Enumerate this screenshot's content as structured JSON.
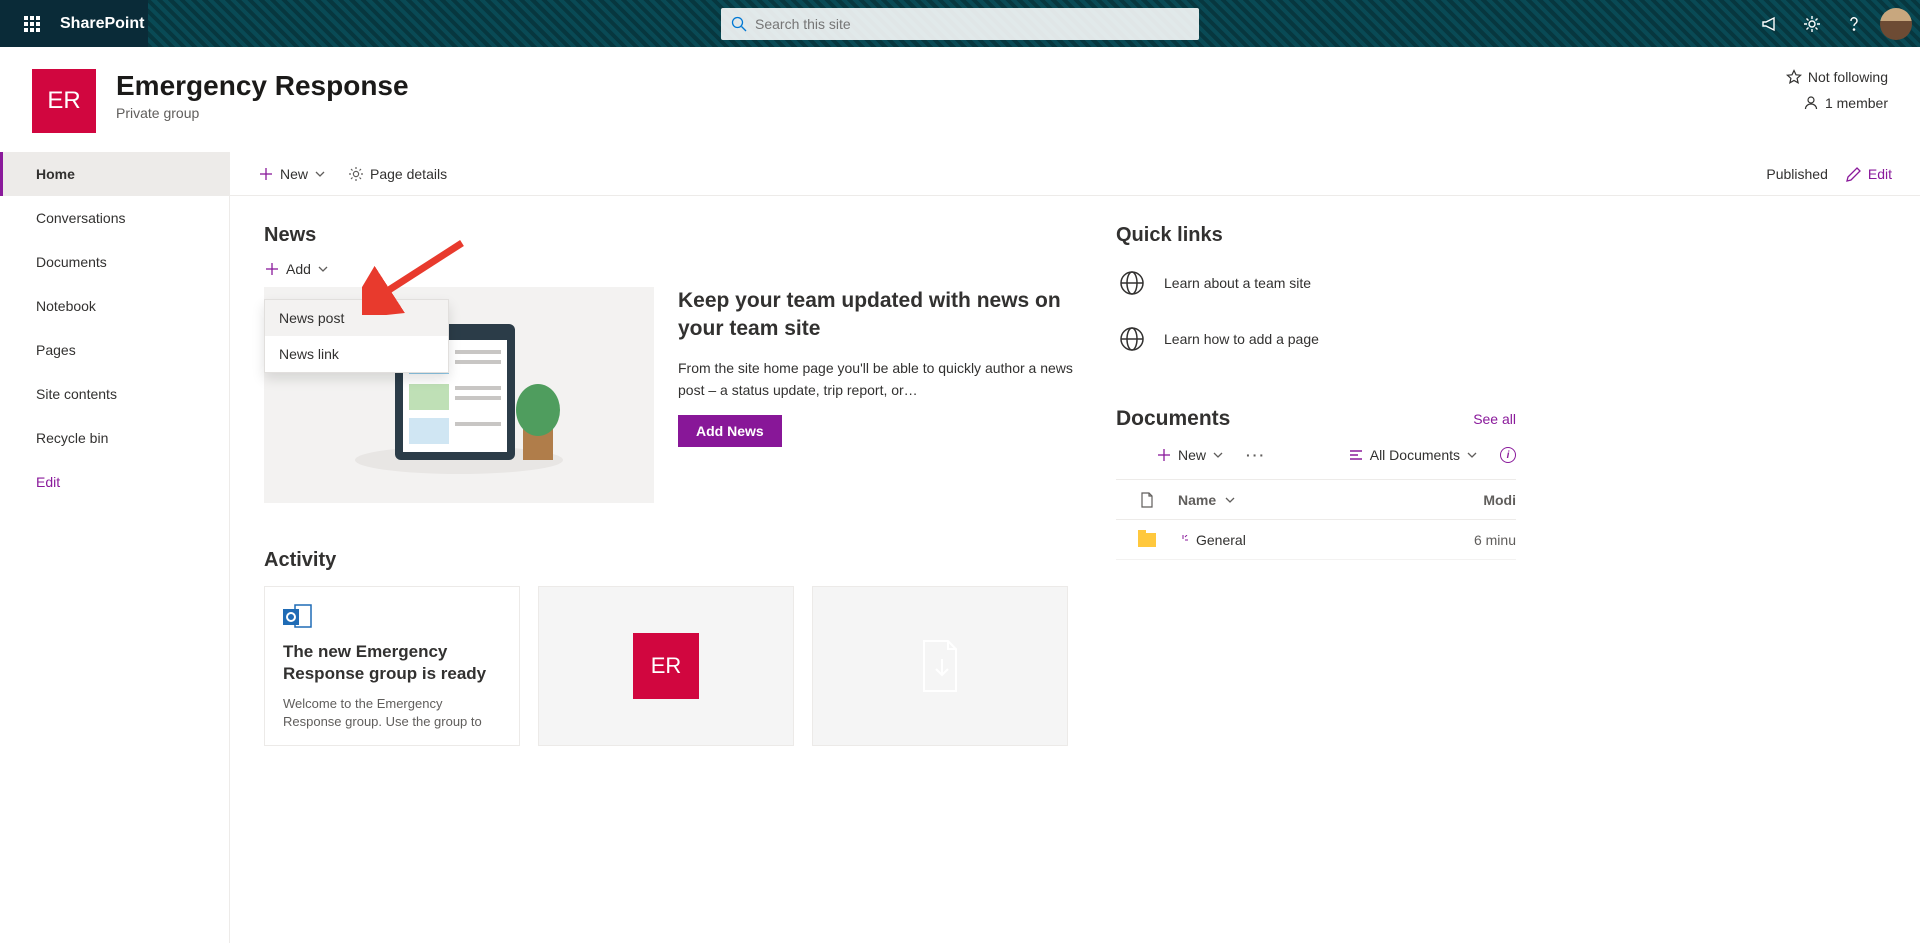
{
  "suite": {
    "app_name": "SharePoint",
    "search_placeholder": "Search this site"
  },
  "site": {
    "logo_text": "ER",
    "name": "Emergency Response",
    "subtitle": "Private group",
    "follow": "Not following",
    "members": "1 member"
  },
  "nav": {
    "items": [
      "Home",
      "Conversations",
      "Documents",
      "Notebook",
      "Pages",
      "Site contents",
      "Recycle bin"
    ],
    "edit": "Edit"
  },
  "cmdbar": {
    "new": "New",
    "page_details": "Page details",
    "published": "Published",
    "edit": "Edit"
  },
  "news": {
    "heading": "News",
    "add": "Add",
    "menu": [
      "News post",
      "News link"
    ],
    "title": "Keep your team updated with news on your team site",
    "desc": "From the site home page you'll be able to quickly author a news post – a status update, trip report, or…",
    "button": "Add News"
  },
  "activity": {
    "heading": "Activity",
    "card1_title": "The new Emergency Response group is ready",
    "card1_body": "Welcome to the Emergency Response group. Use the group to",
    "card2_tile": "ER"
  },
  "quicklinks": {
    "heading": "Quick links",
    "items": [
      "Learn about a team site",
      "Learn how to add a page"
    ]
  },
  "documents": {
    "heading": "Documents",
    "see_all": "See all",
    "new": "New",
    "view": "All Documents",
    "col_name": "Name",
    "col_mod": "Modi",
    "row_name": "General",
    "row_mod": "6 minu"
  }
}
